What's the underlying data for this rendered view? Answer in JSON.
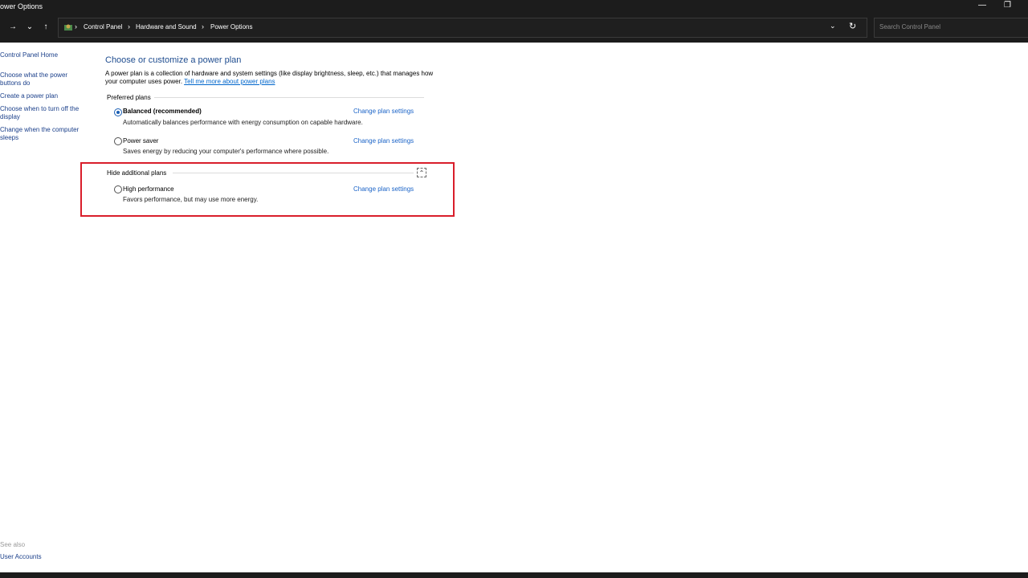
{
  "window": {
    "title": "ower Options",
    "minimize_icon": "minimize-icon",
    "restore_icon": "restore-icon"
  },
  "nav": {
    "forward_icon": "arrow-right-icon",
    "recent_icon": "chevron-down-icon",
    "up_icon": "arrow-up-icon",
    "breadcrumb": [
      "Control Panel",
      "Hardware and Sound",
      "Power Options"
    ],
    "search_placeholder": "Search Control Panel"
  },
  "sidebar": {
    "items": [
      "Control Panel Home",
      "Choose what the power buttons do",
      "Create a power plan",
      "Choose when to turn off the display",
      "Change when the computer sleeps"
    ],
    "see_also_label": "See also",
    "see_also_links": [
      "User Accounts"
    ]
  },
  "main": {
    "heading": "Choose or customize a power plan",
    "description": "A power plan is a collection of hardware and system settings (like display brightness, sleep, etc.) that manages how your computer uses power.",
    "learn_more": "Tell me more about power plans",
    "preferred_label": "Preferred plans",
    "additional_label": "Hide additional plans",
    "change_label": "Change plan settings",
    "plans": [
      {
        "name": "Balanced (recommended)",
        "description": "Automatically balances performance with energy consumption on capable hardware.",
        "selected": true
      },
      {
        "name": "Power saver",
        "description": "Saves energy by reducing your computer's performance where possible.",
        "selected": false
      },
      {
        "name": "High performance",
        "description": "Favors performance, but may use more energy.",
        "selected": false
      }
    ]
  },
  "colors": {
    "highlight_border": "#d91e2b",
    "link": "#1a63c7",
    "heading": "#1e4c8f",
    "titlebar": "#1c1c1c"
  }
}
